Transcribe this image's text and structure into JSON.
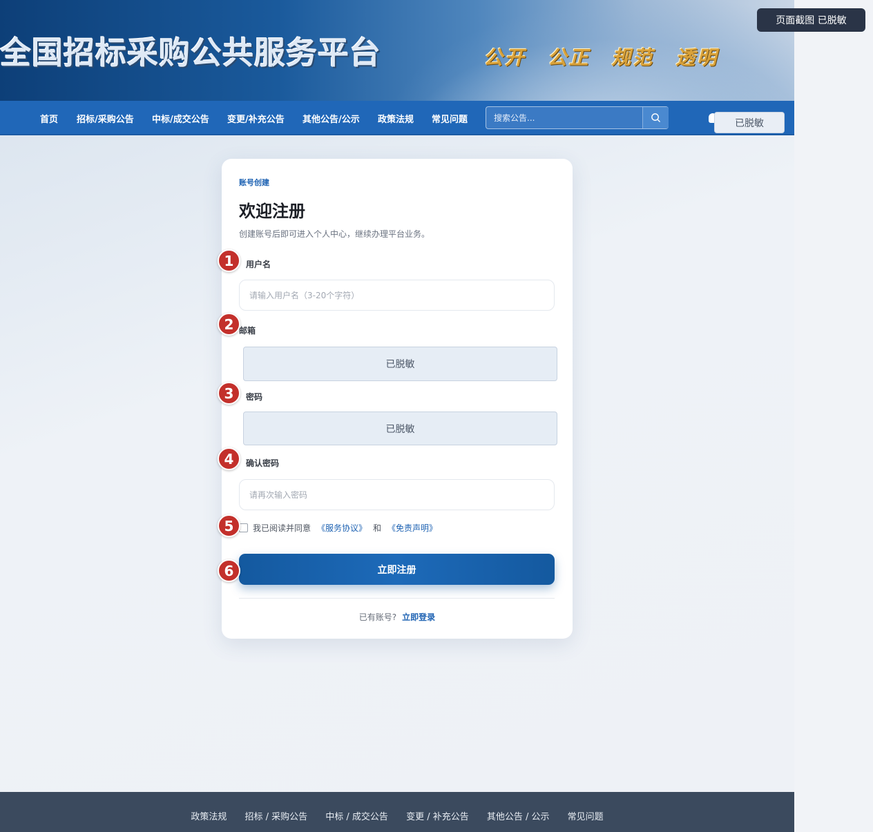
{
  "header": {
    "title": "全国招标采购公共服务平台",
    "slogan": "公开 公正 规范 透明"
  },
  "screenshot_tag": "页面截图  已脱敏",
  "nav": {
    "items": [
      "首页",
      "招标/采购公告",
      "中标/成交公告",
      "变更/补充公告",
      "其他公告/公示",
      "政策法规",
      "常见问题"
    ],
    "search_placeholder": "搜索公告...",
    "user_masked": "已脱敏"
  },
  "form": {
    "eyebrow": "账号创建",
    "title": "欢迎注册",
    "subtitle": "创建账号后即可进入个人中心，继续办理平台业务。",
    "username_label": "用户名",
    "username_placeholder": "请输入用户名（3-20个字符）",
    "email_label": "邮箱",
    "email_masked": "已脱敏",
    "password_label": "密码",
    "password_masked": "已脱敏",
    "confirm_label": "确认密码",
    "confirm_placeholder": "请再次输入密码",
    "agree_text": "我已阅读并同意",
    "service_link": "《服务协议》",
    "and_text": "和",
    "disclaimer_link": "《免责声明》",
    "submit_label": "立即注册",
    "has_account": "已有账号?",
    "login_link": "立即登录"
  },
  "badges": [
    "1",
    "2",
    "3",
    "4",
    "5",
    "6"
  ],
  "footer": {
    "links": [
      "政策法规",
      "招标 / 采购公告",
      "中标 / 成交公告",
      "变更 / 补充公告",
      "其他公告 / 公示",
      "常见问题"
    ]
  },
  "colors": {
    "nav": "#2067b8",
    "accent": "#1f63b3",
    "badge": "#c3302b",
    "footer": "#3b4a5e"
  }
}
